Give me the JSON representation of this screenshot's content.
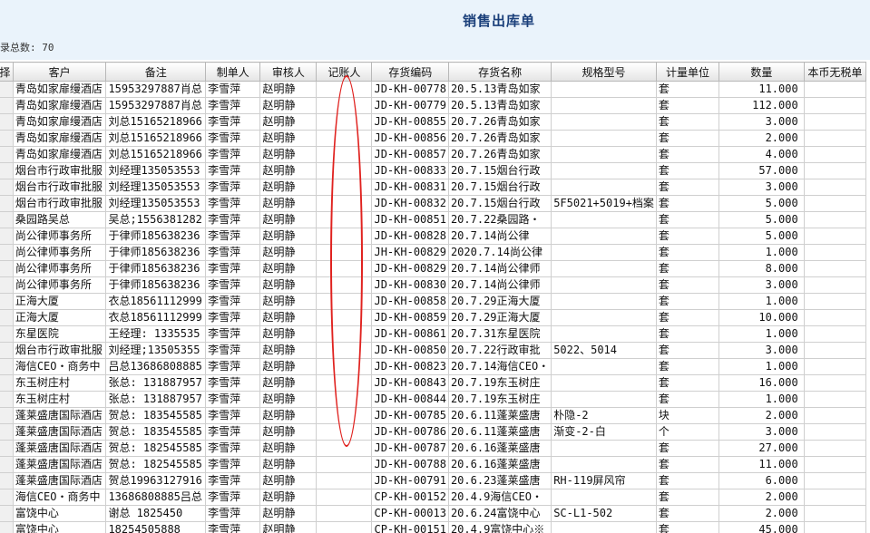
{
  "page": {
    "title": "销售出库单",
    "record_count": "录总数: 70"
  },
  "columns": {
    "select": "择",
    "customer": "客户",
    "remark": "备注",
    "maker": "制单人",
    "auditor": "审核人",
    "bookkeeper": "记账人",
    "item_code": "存货编码",
    "item_name": "存货名称",
    "spec": "规格型号",
    "unit": "计量单位",
    "qty": "数量",
    "price": "本币无税单"
  },
  "rows": [
    {
      "customer": "青岛如家扉缦酒店",
      "remark": "15953297887肖总",
      "maker": "李雪萍",
      "auditor": "赵明静",
      "bookkeeper": "",
      "item_code": "JD-KH-00778",
      "item_name": "20.5.13青岛如家",
      "spec": "",
      "unit": "套",
      "qty": "11.000"
    },
    {
      "customer": "青岛如家扉缦酒店",
      "remark": "15953297887肖总",
      "maker": "李雪萍",
      "auditor": "赵明静",
      "bookkeeper": "",
      "item_code": "JD-KH-00779",
      "item_name": "20.5.13青岛如家",
      "spec": "",
      "unit": "套",
      "qty": "112.000"
    },
    {
      "customer": "青岛如家扉缦酒店",
      "remark": "刘总15165218966",
      "maker": "李雪萍",
      "auditor": "赵明静",
      "bookkeeper": "",
      "item_code": "JD-KH-00855",
      "item_name": "20.7.26青岛如家",
      "spec": "",
      "unit": "套",
      "qty": "3.000"
    },
    {
      "customer": "青岛如家扉缦酒店",
      "remark": "刘总15165218966",
      "maker": "李雪萍",
      "auditor": "赵明静",
      "bookkeeper": "",
      "item_code": "JD-KH-00856",
      "item_name": "20.7.26青岛如家",
      "spec": "",
      "unit": "套",
      "qty": "2.000"
    },
    {
      "customer": "青岛如家扉缦酒店",
      "remark": "刘总15165218966",
      "maker": "李雪萍",
      "auditor": "赵明静",
      "bookkeeper": "",
      "item_code": "JD-KH-00857",
      "item_name": "20.7.26青岛如家",
      "spec": "",
      "unit": "套",
      "qty": "4.000"
    },
    {
      "customer": "烟台市行政审批服",
      "remark": "刘经理135053553",
      "maker": "李雪萍",
      "auditor": "赵明静",
      "bookkeeper": "",
      "item_code": "JD-KH-00833",
      "item_name": "20.7.15烟台行政",
      "spec": "",
      "unit": "套",
      "qty": "57.000"
    },
    {
      "customer": "烟台市行政审批服",
      "remark": "刘经理135053553",
      "maker": "李雪萍",
      "auditor": "赵明静",
      "bookkeeper": "",
      "item_code": "JD-KH-00831",
      "item_name": "20.7.15烟台行政",
      "spec": "",
      "unit": "套",
      "qty": "3.000"
    },
    {
      "customer": "烟台市行政审批服",
      "remark": "刘经理135053553",
      "maker": "李雪萍",
      "auditor": "赵明静",
      "bookkeeper": "",
      "item_code": "JD-KH-00832",
      "item_name": "20.7.15烟台行政",
      "spec": "5F5021+5019+档案",
      "unit": "套",
      "qty": "5.000"
    },
    {
      "customer": "桑园路吴总",
      "remark": "吴总;1556381282",
      "maker": "李雪萍",
      "auditor": "赵明静",
      "bookkeeper": "",
      "item_code": "JD-KH-00851",
      "item_name": "20.7.22桑园路・",
      "spec": "",
      "unit": "套",
      "qty": "5.000"
    },
    {
      "customer": "尚公律师事务所",
      "remark": "于律师185638236",
      "maker": "李雪萍",
      "auditor": "赵明静",
      "bookkeeper": "",
      "item_code": "JD-KH-00828",
      "item_name": "20.7.14尚公律",
      "spec": "",
      "unit": "套",
      "qty": "5.000"
    },
    {
      "customer": "尚公律师事务所",
      "remark": "于律师185638236",
      "maker": "李雪萍",
      "auditor": "赵明静",
      "bookkeeper": "",
      "item_code": "JH-KH-00829",
      "item_name": "2020.7.14尚公律",
      "spec": "",
      "unit": "套",
      "qty": "1.000"
    },
    {
      "customer": "尚公律师事务所",
      "remark": "于律师185638236",
      "maker": "李雪萍",
      "auditor": "赵明静",
      "bookkeeper": "",
      "item_code": "JD-KH-00829",
      "item_name": "20.7.14尚公律师",
      "spec": "",
      "unit": "套",
      "qty": "8.000"
    },
    {
      "customer": "尚公律师事务所",
      "remark": "于律师185638236",
      "maker": "李雪萍",
      "auditor": "赵明静",
      "bookkeeper": "",
      "item_code": "JD-KH-00830",
      "item_name": "20.7.14尚公律师",
      "spec": "",
      "unit": "套",
      "qty": "3.000"
    },
    {
      "customer": "正海大厦",
      "remark": "衣总18561112999",
      "maker": "李雪萍",
      "auditor": "赵明静",
      "bookkeeper": "",
      "item_code": "JD-KH-00858",
      "item_name": "20.7.29正海大厦",
      "spec": "",
      "unit": "套",
      "qty": "1.000"
    },
    {
      "customer": "正海大厦",
      "remark": "衣总18561112999",
      "maker": "李雪萍",
      "auditor": "赵明静",
      "bookkeeper": "",
      "item_code": "JD-KH-00859",
      "item_name": "20.7.29正海大厦",
      "spec": "",
      "unit": "套",
      "qty": "10.000"
    },
    {
      "customer": "东星医院",
      "remark": "王经理: 1335535",
      "maker": "李雪萍",
      "auditor": "赵明静",
      "bookkeeper": "",
      "item_code": "JD-KH-00861",
      "item_name": "20.7.31东星医院",
      "spec": "",
      "unit": "套",
      "qty": "1.000"
    },
    {
      "customer": "烟台市行政审批服",
      "remark": "刘经理;13505355",
      "maker": "李雪萍",
      "auditor": "赵明静",
      "bookkeeper": "",
      "item_code": "JD-KH-00850",
      "item_name": "20.7.22行政审批",
      "spec": "5022、5014",
      "unit": "套",
      "qty": "3.000"
    },
    {
      "customer": "海信CEO・商务中",
      "remark": "吕总13686808885",
      "maker": "李雪萍",
      "auditor": "赵明静",
      "bookkeeper": "",
      "item_code": "JD-KH-00823",
      "item_name": "20.7.14海信CEO・",
      "spec": "",
      "unit": "套",
      "qty": "1.000"
    },
    {
      "customer": "东玉树庄村",
      "remark": "张总: 131887957",
      "maker": "李雪萍",
      "auditor": "赵明静",
      "bookkeeper": "",
      "item_code": "JD-KH-00843",
      "item_name": "20.7.19东玉树庄",
      "spec": "",
      "unit": "套",
      "qty": "16.000"
    },
    {
      "customer": "东玉树庄村",
      "remark": "张总: 131887957",
      "maker": "李雪萍",
      "auditor": "赵明静",
      "bookkeeper": "",
      "item_code": "JD-KH-00844",
      "item_name": "20.7.19东玉树庄",
      "spec": "",
      "unit": "套",
      "qty": "1.000"
    },
    {
      "customer": "蓬莱盛唐国际酒店",
      "remark": "贺总: 183545585",
      "maker": "李雪萍",
      "auditor": "赵明静",
      "bookkeeper": "",
      "item_code": "JD-KH-00785",
      "item_name": "20.6.11蓬莱盛唐",
      "spec": "朴隐-2",
      "unit": "块",
      "qty": "2.000"
    },
    {
      "customer": "蓬莱盛唐国际酒店",
      "remark": "贺总: 183545585",
      "maker": "李雪萍",
      "auditor": "赵明静",
      "bookkeeper": "",
      "item_code": "JD-KH-00786",
      "item_name": "20.6.11蓬莱盛唐",
      "spec": "渐变-2-白",
      "unit": "个",
      "qty": "3.000"
    },
    {
      "customer": "蓬莱盛唐国际酒店",
      "remark": "贺总: 182545585",
      "maker": "李雪萍",
      "auditor": "赵明静",
      "bookkeeper": "",
      "item_code": "JD-KH-00787",
      "item_name": "20.6.16蓬莱盛唐",
      "spec": "",
      "unit": "套",
      "qty": "27.000"
    },
    {
      "customer": "蓬莱盛唐国际酒店",
      "remark": "贺总: 182545585",
      "maker": "李雪萍",
      "auditor": "赵明静",
      "bookkeeper": "",
      "item_code": "JD-KH-00788",
      "item_name": "20.6.16蓬莱盛唐",
      "spec": "",
      "unit": "套",
      "qty": "11.000"
    },
    {
      "customer": "蓬莱盛唐国际酒店",
      "remark": "贺总19963127916",
      "maker": "李雪萍",
      "auditor": "赵明静",
      "bookkeeper": "",
      "item_code": "JD-KH-00791",
      "item_name": "20.6.23蓬莱盛唐",
      "spec": "RH-119屏风帘",
      "unit": "套",
      "qty": "6.000"
    },
    {
      "customer": "海信CEO・商务中",
      "remark": "13686808885吕总",
      "maker": "李雪萍",
      "auditor": "赵明静",
      "bookkeeper": "",
      "item_code": "CP-KH-00152",
      "item_name": "20.4.9海信CEO・",
      "spec": "",
      "unit": "套",
      "qty": "2.000"
    },
    {
      "customer": "富饶中心",
      "remark": "谢总   1825450",
      "maker": "李雪萍",
      "auditor": "赵明静",
      "bookkeeper": "",
      "item_code": "CP-KH-00013",
      "item_name": "20.6.24富饶中心",
      "spec": "SC-L1-502",
      "unit": "套",
      "qty": "2.000"
    },
    {
      "customer": "富饶中心",
      "remark": "18254505888",
      "maker": "李雪萍",
      "auditor": "赵明静",
      "bookkeeper": "",
      "item_code": "CP-KH-00151",
      "item_name": "20.4.9富饶中心※",
      "spec": "",
      "unit": "套",
      "qty": "45.000"
    }
  ]
}
